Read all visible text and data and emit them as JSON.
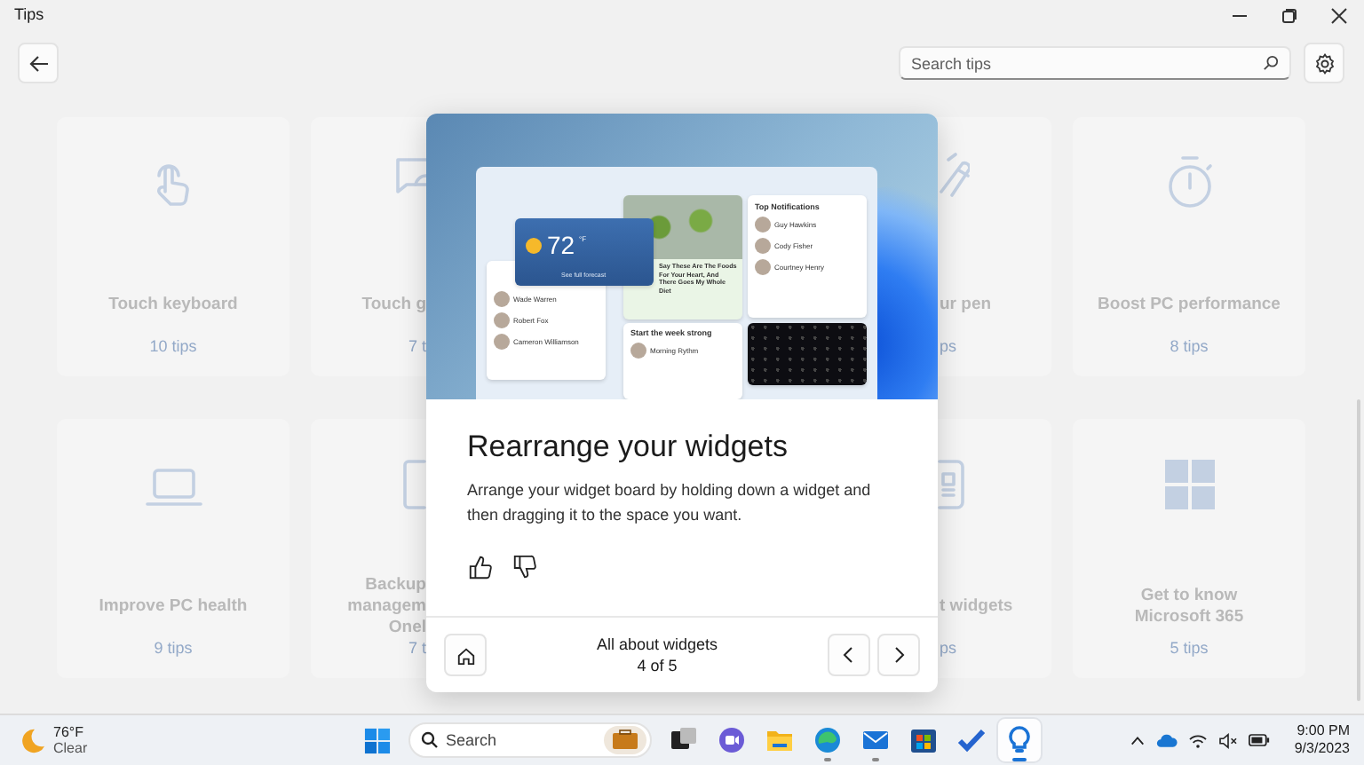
{
  "window": {
    "title": "Tips"
  },
  "toolbar": {
    "search": {
      "placeholder": "Search tips"
    }
  },
  "categories": [
    {
      "kind": "touch",
      "title": "Touch keyboard",
      "tips": "10 tips"
    },
    {
      "kind": "gesture",
      "title": "Touch g",
      "tips": "7 t"
    },
    {
      "kind": "pen",
      "title": "ur pen",
      "tips": "ps"
    },
    {
      "kind": "stopwatch",
      "title": "Boost PC performance",
      "tips": "8 tips"
    },
    {
      "kind": "laptop",
      "title": "Improve PC health",
      "tips": "9 tips"
    },
    {
      "kind": "tablet",
      "title": "Backup\nmanagem\nOnel",
      "tips": "7 t"
    },
    {
      "kind": "phone",
      "title": "t widgets",
      "tips": "ps"
    },
    {
      "kind": "windows",
      "title": "Get to know\nMicrosoft 365",
      "tips": "5 tips"
    }
  ],
  "dialog": {
    "illustration": {
      "weather": {
        "temp": "72",
        "unit": "°F",
        "link": "See full forecast"
      },
      "news": {
        "headline": "Say These Are The Foods For Your Heart, And There Goes My Whole Diet"
      },
      "notifications": {
        "title": "Top Notifications",
        "people": [
          "Guy Hawkins",
          "Cody Fisher",
          "Courtney Henry"
        ]
      },
      "messages": {
        "people": [
          "Wade Warren",
          "Robert Fox",
          "Cameron Williamson"
        ]
      },
      "music": {
        "title": "Start the week strong",
        "track": "Morning Rythm"
      }
    },
    "title": "Rearrange your widgets",
    "description": "Arrange your widget board by holding down a widget and then dragging it to the space you want.",
    "collection": "All about widgets",
    "position": "4 of 5"
  },
  "taskbar": {
    "weather": {
      "temp": "76°F",
      "condition": "Clear"
    },
    "search": {
      "placeholder": "Search"
    },
    "apps": [
      {
        "kind": "taskview",
        "running": false,
        "selected": false
      },
      {
        "kind": "teams",
        "running": false,
        "selected": false
      },
      {
        "kind": "explorer",
        "running": false,
        "selected": false
      },
      {
        "kind": "edge",
        "running": true,
        "selected": false
      },
      {
        "kind": "mail",
        "running": true,
        "selected": false
      },
      {
        "kind": "store",
        "running": false,
        "selected": false
      },
      {
        "kind": "todo",
        "running": false,
        "selected": false
      },
      {
        "kind": "tips",
        "running": true,
        "selected": true
      }
    ],
    "time": "9:00 PM",
    "date": "9/3/2023"
  }
}
